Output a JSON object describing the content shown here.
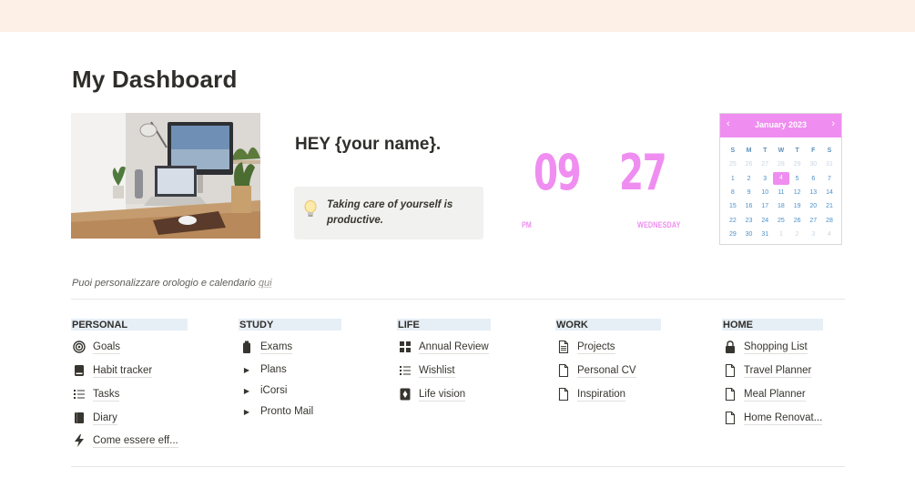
{
  "page": {
    "title": "My Dashboard"
  },
  "greeting": {
    "text": "HEY {your name}.",
    "quote": "Taking care of yourself is productive.",
    "quote_icon": "lightbulb-icon"
  },
  "clock": {
    "hours": "09",
    "minutes": "27",
    "ampm": "PM",
    "day": "WEDNESDAY",
    "color": "#ef8ef0"
  },
  "calendar": {
    "title": "January 2023",
    "prev_label": "‹",
    "next_label": "›",
    "weekdays": [
      "S",
      "M",
      "T",
      "W",
      "T",
      "F",
      "S"
    ],
    "weeks": [
      [
        "25",
        "26",
        "27",
        "28",
        "29",
        "30",
        "31"
      ],
      [
        "1",
        "2",
        "3",
        "4",
        "5",
        "6",
        "7"
      ],
      [
        "8",
        "9",
        "10",
        "11",
        "12",
        "13",
        "14"
      ],
      [
        "15",
        "16",
        "17",
        "18",
        "19",
        "20",
        "21"
      ],
      [
        "22",
        "23",
        "24",
        "25",
        "26",
        "27",
        "28"
      ],
      [
        "29",
        "30",
        "31",
        "1",
        "2",
        "3",
        "4"
      ]
    ],
    "today": "4",
    "accent": "#ef8ef0"
  },
  "hint": {
    "text": "Puoi personalizzare orologio e calendario ",
    "link": "qui"
  },
  "sections": {
    "personal": {
      "title": "PERSONAL",
      "items": [
        {
          "label": "Goals",
          "icon": "target-icon"
        },
        {
          "label": "Habit tracker",
          "icon": "book-icon"
        },
        {
          "label": "Tasks",
          "icon": "checklist-icon"
        },
        {
          "label": "Diary",
          "icon": "journal-icon"
        },
        {
          "label": "Come essere eff...",
          "icon": "lightning-icon"
        }
      ]
    },
    "study": {
      "title": "STUDY",
      "items": [
        {
          "label": "Exams",
          "icon": "bottle-icon"
        },
        {
          "label": "Plans",
          "icon": "triangle-right-icon"
        },
        {
          "label": "iCorsi",
          "icon": "triangle-right-icon"
        },
        {
          "label": "Pronto Mail",
          "icon": "triangle-right-icon"
        }
      ]
    },
    "life": {
      "title": "LIFE",
      "items": [
        {
          "label": "Annual Review",
          "icon": "grid-icon"
        },
        {
          "label": "Wishlist",
          "icon": "list-icon"
        },
        {
          "label": "Life vision",
          "icon": "compass-icon"
        }
      ]
    },
    "work": {
      "title": "WORK",
      "items": [
        {
          "label": "Projects",
          "icon": "document-lines-icon"
        },
        {
          "label": "Personal CV",
          "icon": "document-icon"
        },
        {
          "label": "Inspiration",
          "icon": "document-icon"
        }
      ]
    },
    "home": {
      "title": "HOME",
      "items": [
        {
          "label": "Shopping List",
          "icon": "lock-icon"
        },
        {
          "label": "Travel Planner",
          "icon": "document-icon"
        },
        {
          "label": "Meal Planner",
          "icon": "document-icon"
        },
        {
          "label": "Home Renovat...",
          "icon": "document-icon"
        }
      ]
    }
  }
}
